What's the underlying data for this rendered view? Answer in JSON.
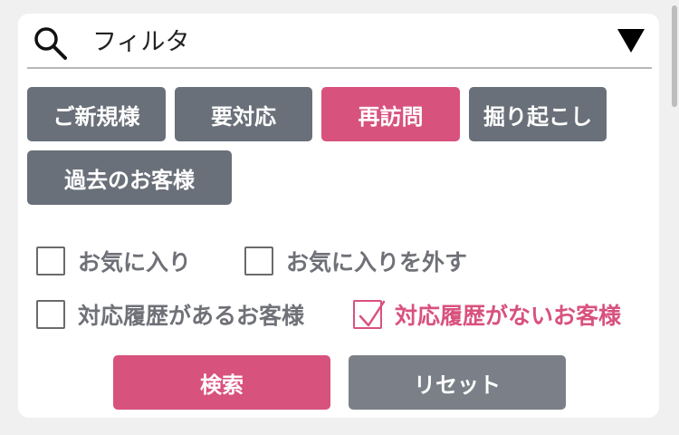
{
  "filter": {
    "title": "フィルタ",
    "search_icon": "search-icon",
    "dropdown_icon": "triangle-down-icon"
  },
  "tags": [
    {
      "label": "ご新規様",
      "active": false
    },
    {
      "label": "要対応",
      "active": false
    },
    {
      "label": "再訪問",
      "active": true
    },
    {
      "label": "掘り起こし",
      "active": false
    },
    {
      "label": "過去のお客様",
      "active": false
    }
  ],
  "checkboxes": [
    {
      "label": "お気に入り",
      "checked": false
    },
    {
      "label": "お気に入りを外す",
      "checked": false
    },
    {
      "label": "対応履歴があるお客様",
      "checked": false
    },
    {
      "label": "対応履歴がないお客様",
      "checked": true
    }
  ],
  "buttons": {
    "search_label": "検索",
    "reset_label": "リセット"
  },
  "colors": {
    "accent": "#d8527e",
    "tag_default": "#6a7079",
    "reset_button": "#7b8088",
    "label_text": "#6f7177"
  }
}
